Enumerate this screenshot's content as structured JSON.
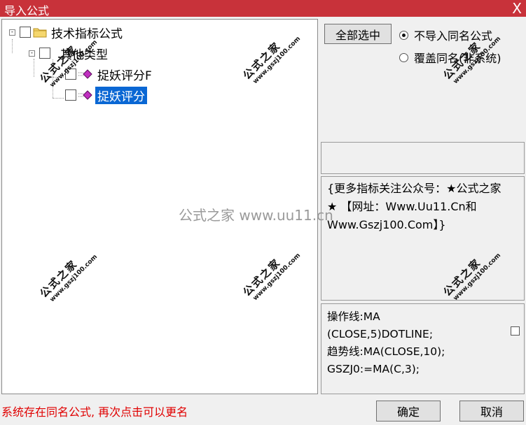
{
  "window": {
    "title": "导入公式",
    "close_glyph": "X"
  },
  "tree": {
    "root_label": "技术指标公式",
    "group_label": "其他类型",
    "items": [
      {
        "label": "捉妖评分F",
        "selected": false
      },
      {
        "label": "捉妖评分",
        "selected": true
      }
    ]
  },
  "actions": {
    "select_all_label": "全部选中",
    "radio_options": [
      {
        "label": "不导入同名公式",
        "checked": true
      },
      {
        "label": "覆盖同名(非系统)",
        "checked": false
      }
    ]
  },
  "description": {
    "text": "{更多指标关注公众号：★公式之家★ 【网址：Www.Uu11.Cn和Www.Gszj100.Com】}"
  },
  "code": {
    "lines": [
      "操作线:MA",
      "(CLOSE,5)DOTLINE;",
      "趋势线:MA(CLOSE,10);",
      "GSZJ0:=MA(C,3);"
    ]
  },
  "status": {
    "message": "系统存在同名公式, 再次点击可以更名"
  },
  "footer": {
    "confirm_label": "确定",
    "cancel_label": "取消"
  },
  "watermark": {
    "text": "公式之家",
    "url": "www.gszj100.com",
    "center_text": "公式之家 www.uu11.cn"
  },
  "colors": {
    "titlebar": "#c8323a",
    "selection": "#0a67d4",
    "status": "#e00000"
  }
}
